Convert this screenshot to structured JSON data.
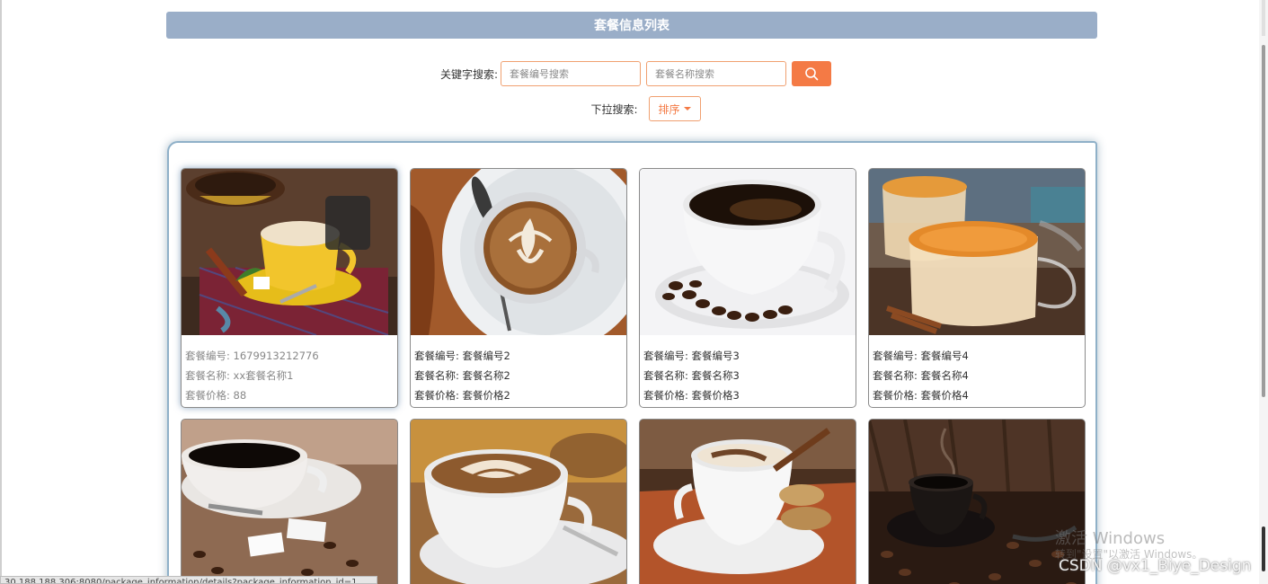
{
  "header": {
    "title": "套餐信息列表"
  },
  "search": {
    "label": "关键字搜索:",
    "code_placeholder": "套餐编号搜索",
    "name_placeholder": "套餐名称搜索",
    "button_icon": "search-icon"
  },
  "filter": {
    "label": "下拉搜索:",
    "sort_label": "排序"
  },
  "cards": [
    {
      "code": "套餐编号: 1679913212776",
      "name": "套餐名称: xx套餐名称1",
      "price": "套餐价格: 88",
      "image": "coffee-yellow-cup"
    },
    {
      "code": "套餐编号: 套餐编号2",
      "name": "套餐名称: 套餐名称2",
      "price": "套餐价格: 套餐价格2",
      "image": "latte-art-plate"
    },
    {
      "code": "套餐编号: 套餐编号3",
      "name": "套餐名称: 套餐名称3",
      "price": "套餐价格: 套餐价格3",
      "image": "espresso-white-cup"
    },
    {
      "code": "套餐编号: 套餐编号4",
      "name": "套餐名称: 套餐名称4",
      "price": "套餐价格: 套餐价格4",
      "image": "glass-cups-spice"
    },
    {
      "image": "black-coffee-sugar"
    },
    {
      "image": "cappuccino-latte-art"
    },
    {
      "image": "coffee-cinnamon-cookies"
    },
    {
      "image": "dark-coffee-beans"
    }
  ],
  "overlay": {
    "watermark_title": "激活 Windows",
    "watermark_sub": "转到\"设置\"以激活 Windows。",
    "csdn": "CSDN @vx1_Biye_Design",
    "status_url": "30.188.188.306:8080/package_information/details?package_information_id=1"
  }
}
